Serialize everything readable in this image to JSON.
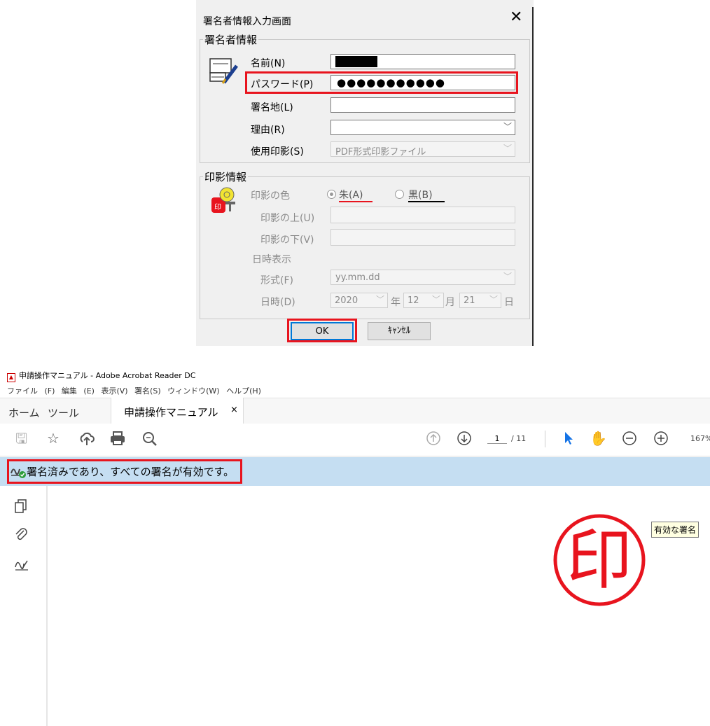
{
  "dialog": {
    "title": "署名者情報入力画面",
    "close_glyph": "✕",
    "signer_group": {
      "legend": "署名者情報",
      "name_label": "名前(N)",
      "password_label": "パスワード(P)",
      "password_value": "●●●●●●●●●●●",
      "location_label": "署名地(L)",
      "reason_label": "理由(R)",
      "stamp_label": "使用印影(S)",
      "stamp_value": "PDF形式印影ファイル"
    },
    "stamp_group": {
      "legend": "印影情報",
      "color_label": "印影の色",
      "option_red": "朱(A)",
      "option_black": "黒(B)",
      "top_label": "印影の上(U)",
      "bottom_label": "印影の下(V)",
      "datetime_display": "日時表示",
      "format_label": "形式(F)",
      "format_value": "yy.mm.dd",
      "date_label": "日時(D)",
      "year": "2020",
      "year_unit": "年",
      "month": "12",
      "month_unit": "月",
      "day": "21",
      "day_unit": "日"
    },
    "ok_label": "OK",
    "cancel_label": "ｷｬﾝｾﾙ"
  },
  "acrobat": {
    "window_title": "申請操作マニュアル - Adobe Acrobat Reader DC",
    "menu": [
      "ファイル (F)",
      "編集 (E)",
      "表示(V)",
      "署名(S)",
      "ウィンドウ(W)",
      "ヘルプ(H)"
    ],
    "tabs": {
      "home": "ホーム",
      "tools": "ツール",
      "document": "申請操作マニュアル",
      "close": "×"
    },
    "page_current": "1",
    "page_total": "/ 11",
    "zoom": "167%",
    "signature_status": "署名済みであり、すべての署名が有効です。",
    "seal_character": "印",
    "seal_tooltip": "有効な署名"
  },
  "colors": {
    "highlight": "#e8141e",
    "sig_bar": "#c5def2",
    "seal": "#e8141e"
  }
}
